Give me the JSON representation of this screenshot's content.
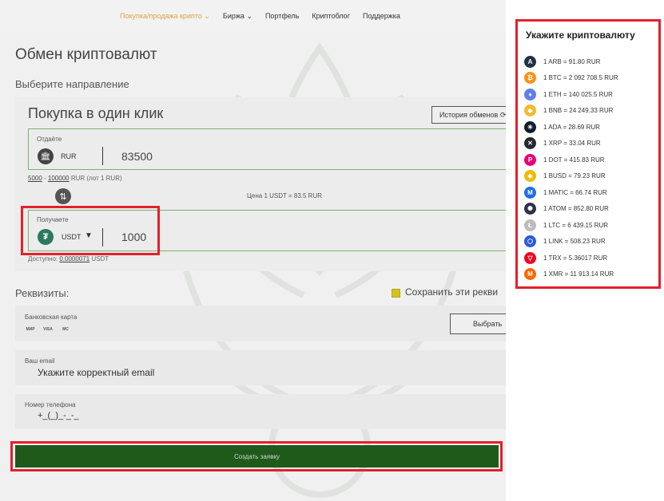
{
  "nav": {
    "items": [
      "Покупка/продажа крипто ⌄",
      "Биржа ⌄",
      "Портфель",
      "Криптоблог",
      "Поддержка"
    ],
    "active_index": 0,
    "active_color": "#d9a441"
  },
  "page": {
    "title": "Обмен криптовалют",
    "direction_label": "Выберите направление"
  },
  "exchange": {
    "card_title": "Покупка в один клик",
    "history_button": "История обменов ⟳",
    "give": {
      "label": "Отдаёте",
      "icon": "bank-icon",
      "currency": "RUR",
      "amount": "83500"
    },
    "limits": {
      "min": "5000",
      "dash": " - ",
      "max": "100000",
      "suffix": " RUR (лот 1 RUR)"
    },
    "swap_icon": "⇅",
    "price": "Цена 1 USDT = 83.5 RUR",
    "get": {
      "label": "Получаете",
      "icon": "usdt-icon",
      "currency": "USDT",
      "caret": "▼",
      "amount": "1000"
    },
    "available": {
      "prefix": "Доступно: ",
      "value": "0.0000071",
      "suffix": " USDT"
    }
  },
  "requisites": {
    "label": "Реквизиты:",
    "save_label": "Сохранить эти рекви",
    "bank_card": {
      "label": "Банковская карта",
      "logos": [
        "МИР",
        "VISA",
        "MC"
      ],
      "select_button": "Выбрать"
    },
    "email": {
      "label": "Ваш email",
      "value": "Укажите корректный email"
    },
    "phone": {
      "label": "Номер телефона",
      "value": "+_(_)_-_-_"
    }
  },
  "submit_button": "Создать заявку",
  "highlight_color": "#e3202c",
  "crypto_panel": {
    "title": "Укажите криптовалюту",
    "items": [
      {
        "text": "1 ARB = 91.80 RUR",
        "icon": "arb-icon",
        "glyph": "A",
        "color": "#213147"
      },
      {
        "text": "1 BTC = 2 092 708.5 RUR",
        "icon": "btc-icon",
        "glyph": "₿",
        "color": "#f7931a"
      },
      {
        "text": "1 ETH = 140 025.5 RUR",
        "icon": "eth-icon",
        "glyph": "♦",
        "color": "#627eea"
      },
      {
        "text": "1 BNB = 24 249.33 RUR",
        "icon": "bnb-icon",
        "glyph": "◆",
        "color": "#f3ba2f"
      },
      {
        "text": "1 ADA = 28.69 RUR",
        "icon": "ada-icon",
        "glyph": "✳",
        "color": "#0d1e30"
      },
      {
        "text": "1 XRP = 33.04 RUR",
        "icon": "xrp-icon",
        "glyph": "✕",
        "color": "#23292f"
      },
      {
        "text": "1 DOT = 415.83 RUR",
        "icon": "dot-icon",
        "glyph": "P",
        "color": "#e6007a"
      },
      {
        "text": "1 BUSD = 79.23 RUR",
        "icon": "busd-icon",
        "glyph": "◈",
        "color": "#f0b90b"
      },
      {
        "text": "1 MATIC = 66.74 RUR",
        "icon": "matic-icon",
        "glyph": "M",
        "color": "#1f6fe0"
      },
      {
        "text": "1 ATOM = 852.80 RUR",
        "icon": "atom-icon",
        "glyph": "✺",
        "color": "#2e3148"
      },
      {
        "text": "1 LTC = 6 439.15 RUR",
        "icon": "ltc-icon",
        "glyph": "Ł",
        "color": "#bfbbbb"
      },
      {
        "text": "1 LINK = 508.23 RUR",
        "icon": "link-icon",
        "glyph": "⬡",
        "color": "#2a5ada"
      },
      {
        "text": "1 TRX = 5.36017 RUR",
        "icon": "trx-icon",
        "glyph": "▽",
        "color": "#ec0623"
      },
      {
        "text": "1 XMR = 11 913.14 RUR",
        "icon": "xmr-icon",
        "glyph": "M",
        "color": "#ff6600"
      }
    ]
  }
}
